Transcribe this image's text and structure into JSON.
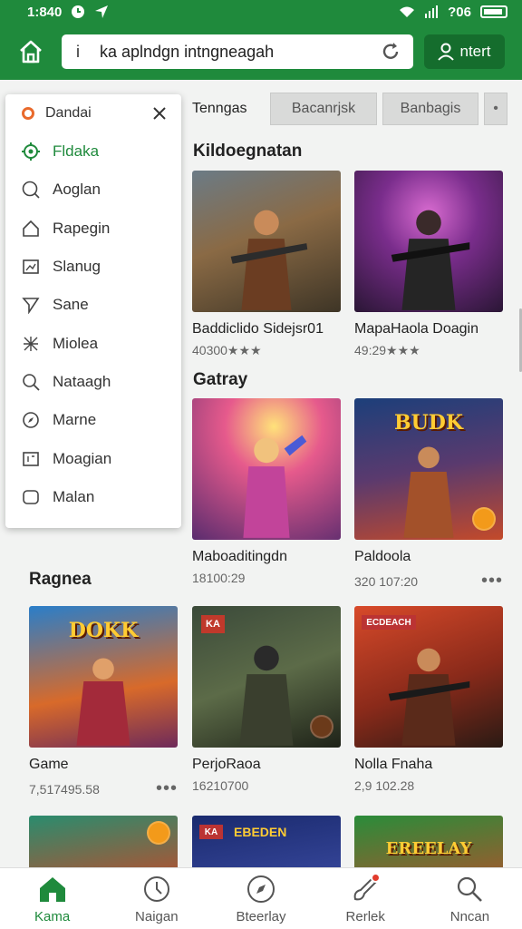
{
  "status": {
    "time": "1:840",
    "battery_text": "?06"
  },
  "appbar": {
    "url": "ka aplndgn intngneagah",
    "info_glyph": "i",
    "signin_label": "ntert"
  },
  "tabs": {
    "plain": "Tenngas",
    "chips": [
      "Bacanrjsk",
      "Banbagis"
    ]
  },
  "menu": {
    "header": "Dandai",
    "items": [
      {
        "label": "Fldaka",
        "icon": "target-icon",
        "active": true
      },
      {
        "label": "Aoglan",
        "icon": "search-circle-icon"
      },
      {
        "label": "Rapegin",
        "icon": "home-icon"
      },
      {
        "label": "Slanug",
        "icon": "image-icon"
      },
      {
        "label": "Sane",
        "icon": "send-icon"
      },
      {
        "label": "Miolea",
        "icon": "puzzle-icon"
      },
      {
        "label": "Nataagh",
        "icon": "search-icon"
      },
      {
        "label": "Marne",
        "icon": "compass-icon"
      },
      {
        "label": "Moagian",
        "icon": "grid-icon"
      },
      {
        "label": "Malan",
        "icon": "square-icon"
      }
    ]
  },
  "sections": {
    "s1": "Kildoegnatan",
    "s2": "Gatray",
    "s3": "Ragnea"
  },
  "cards": {
    "c1": {
      "title": "Baddiclido Sidejsr01",
      "meta": "40300★★★"
    },
    "c2": {
      "title": "MapaHaola Doagin",
      "meta": "49:29★★★"
    },
    "c3": {
      "title": "Maboaditingdn",
      "meta": "18100:29"
    },
    "c4": {
      "title": "Paldoola",
      "meta": "320 107:20"
    },
    "c5": {
      "title": "Game",
      "meta": "7,517495.58"
    },
    "c6": {
      "title": "PerjoRaoa",
      "meta": "16210700"
    },
    "c7": {
      "title": "Nolla Fnaha",
      "meta": "2,9 102.28"
    },
    "c5_logo": "DOKK",
    "c4_logo": "BUDK",
    "c6_tag": "KA",
    "c7_tag": "ECDEACH",
    "c8_tag": "KA",
    "c9_tag": "EBEDEN",
    "c10_logo": "EREELAY"
  },
  "bottomnav": [
    {
      "label": "Kama",
      "icon": "home-icon",
      "active": true
    },
    {
      "label": "Naigan",
      "icon": "clock-icon"
    },
    {
      "label": "Bteerlay",
      "icon": "compass-icon"
    },
    {
      "label": "Rerlek",
      "icon": "guitar-icon"
    },
    {
      "label": "Nncan",
      "icon": "search-icon"
    }
  ],
  "colors": {
    "brand": "#1f8a3c",
    "brand_dark": "#156d2d",
    "accent": "#e96a2c"
  }
}
